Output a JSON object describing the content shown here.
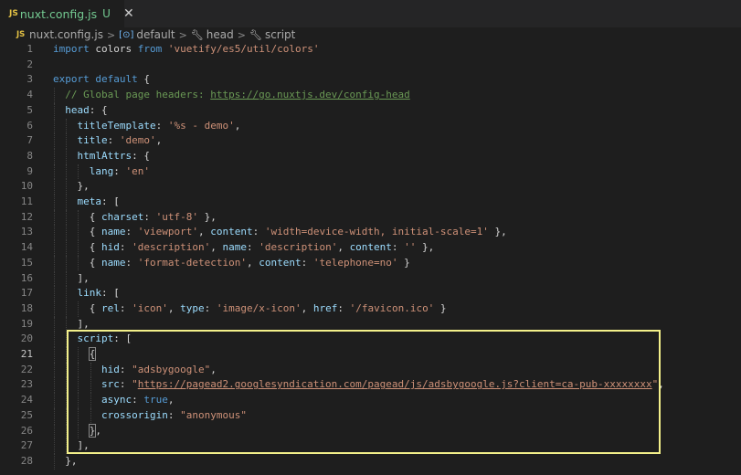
{
  "tab": {
    "badge": "JS",
    "filename": "nuxt.config.js",
    "status": "U",
    "close": "✕"
  },
  "breadcrumb": {
    "badge": "JS",
    "file": "nuxt.config.js",
    "items": [
      "default",
      "head",
      "script"
    ],
    "separator": ">"
  },
  "editor": {
    "active_line": 21,
    "lines": [
      {
        "n": "1",
        "html": "<span class=\"k\">import</span> <span class=\"v\">colors</span> <span class=\"k\">from</span> <span class=\"s\">'vuetify/es5/util/colors'</span>"
      },
      {
        "n": "2",
        "html": ""
      },
      {
        "n": "3",
        "html": "<span class=\"k\">export</span> <span class=\"k\">default</span> <span class=\"pl\">{</span>"
      },
      {
        "n": "4",
        "html": "  <span class=\"c\">// Global page headers: </span><span class=\"url\">https://go.nuxtjs.dev/config-head</span>"
      },
      {
        "n": "5",
        "html": "  <span class=\"p\">head</span><span class=\"pl\">: {</span>"
      },
      {
        "n": "6",
        "html": "    <span class=\"p\">titleTemplate</span><span class=\"pl\">: </span><span class=\"s\">'%s - demo'</span><span class=\"pl\">,</span>"
      },
      {
        "n": "7",
        "html": "    <span class=\"p\">title</span><span class=\"pl\">: </span><span class=\"s\">'demo'</span><span class=\"pl\">,</span>"
      },
      {
        "n": "8",
        "html": "    <span class=\"p\">htmlAttrs</span><span class=\"pl\">: {</span>"
      },
      {
        "n": "9",
        "html": "      <span class=\"p\">lang</span><span class=\"pl\">: </span><span class=\"s\">'en'</span>"
      },
      {
        "n": "10",
        "html": "    <span class=\"pl\">},</span>"
      },
      {
        "n": "11",
        "html": "    <span class=\"p\">meta</span><span class=\"pl\">: [</span>"
      },
      {
        "n": "12",
        "html": "      <span class=\"pl\">{ </span><span class=\"p\">charset</span><span class=\"pl\">: </span><span class=\"s\">'utf-8'</span><span class=\"pl\"> },</span>"
      },
      {
        "n": "13",
        "html": "      <span class=\"pl\">{ </span><span class=\"p\">name</span><span class=\"pl\">: </span><span class=\"s\">'viewport'</span><span class=\"pl\">, </span><span class=\"p\">content</span><span class=\"pl\">: </span><span class=\"s\">'width=device-width, initial-scale=1'</span><span class=\"pl\"> },</span>"
      },
      {
        "n": "14",
        "html": "      <span class=\"pl\">{ </span><span class=\"p\">hid</span><span class=\"pl\">: </span><span class=\"s\">'description'</span><span class=\"pl\">, </span><span class=\"p\">name</span><span class=\"pl\">: </span><span class=\"s\">'description'</span><span class=\"pl\">, </span><span class=\"p\">content</span><span class=\"pl\">: </span><span class=\"s\">''</span><span class=\"pl\"> },</span>"
      },
      {
        "n": "15",
        "html": "      <span class=\"pl\">{ </span><span class=\"p\">name</span><span class=\"pl\">: </span><span class=\"s\">'format-detection'</span><span class=\"pl\">, </span><span class=\"p\">content</span><span class=\"pl\">: </span><span class=\"s\">'telephone=no'</span><span class=\"pl\"> }</span>"
      },
      {
        "n": "16",
        "html": "    <span class=\"pl\">],</span>"
      },
      {
        "n": "17",
        "html": "    <span class=\"p\">link</span><span class=\"pl\">: [</span>"
      },
      {
        "n": "18",
        "html": "      <span class=\"pl\">{ </span><span class=\"p\">rel</span><span class=\"pl\">: </span><span class=\"s\">'icon'</span><span class=\"pl\">, </span><span class=\"p\">type</span><span class=\"pl\">: </span><span class=\"s\">'image/x-icon'</span><span class=\"pl\">, </span><span class=\"p\">href</span><span class=\"pl\">: </span><span class=\"s\">'/favicon.ico'</span><span class=\"pl\"> }</span>"
      },
      {
        "n": "19",
        "html": "    <span class=\"pl\">],</span>"
      },
      {
        "n": "20",
        "html": "    <span class=\"p\">script</span><span class=\"pl\">: [</span>"
      },
      {
        "n": "21",
        "html": "      <span class=\"pl bm\">{</span>"
      },
      {
        "n": "22",
        "html": "        <span class=\"p\">hid</span><span class=\"pl\">: </span><span class=\"s\">\"adsbygoogle\"</span><span class=\"pl\">,</span>"
      },
      {
        "n": "23",
        "html": "        <span class=\"p\">src</span><span class=\"pl\">: </span><span class=\"s\">\"</span><span class=\"surl\">https://pagead2.googlesyndication.com/pagead/js/adsbygoogle.js?client=ca-pub-xxxxxxxx</span><span class=\"s\">\"</span><span class=\"pl\">,</span>"
      },
      {
        "n": "24",
        "html": "        <span class=\"p\">async</span><span class=\"pl\">: </span><span class=\"bool\">true</span><span class=\"pl\">,</span>"
      },
      {
        "n": "25",
        "html": "        <span class=\"p\">crossorigin</span><span class=\"pl\">: </span><span class=\"s\">\"anonymous\"</span>"
      },
      {
        "n": "26",
        "html": "      <span class=\"pl bm\">}</span><span class=\"pl\">,</span>"
      },
      {
        "n": "27",
        "html": "    <span class=\"pl\">],</span>"
      },
      {
        "n": "28",
        "html": "  <span class=\"pl\">},</span>"
      }
    ]
  },
  "colors": {
    "background": "#1e1e1e",
    "highlight_border": "#f3f08a",
    "modified_file": "#73c991"
  }
}
